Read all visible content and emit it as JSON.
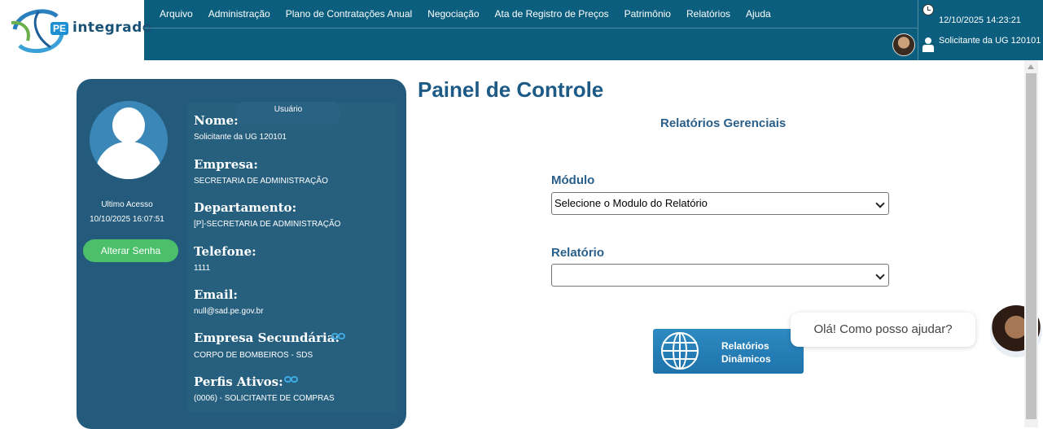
{
  "brand": {
    "badge": "PE",
    "name": "integrado"
  },
  "menu": [
    "Arquivo",
    "Administração",
    "Plano de Contratações Anual",
    "Negociação",
    "Ata de Registro de Preços",
    "Patrimônio",
    "Relatórios",
    "Ajuda"
  ],
  "status": {
    "datetime": "12/10/2025 14:23:21",
    "role": "Solicitante da UG 120101"
  },
  "profile": {
    "tab_label": "Usuário",
    "last_access_label": "Ultimo Acesso",
    "last_access_value": "10/10/2025 16:07:51",
    "change_password": "Alterar Senha",
    "fields": [
      {
        "label": "Nome:",
        "value": "Solicitante da UG 120101"
      },
      {
        "label": "Empresa:",
        "value": "SECRETARIA DE ADMINISTRAÇÃO"
      },
      {
        "label": "Departamento:",
        "value": "[P]-SECRETARIA DE ADMINISTRAÇÃO"
      },
      {
        "label": "Telefone:",
        "value": "1111"
      },
      {
        "label": "Email:",
        "value": "null@sad.pe.gov.br"
      },
      {
        "label": "Empresa Secundária:",
        "value": "CORPO DE BOMBEIROS - SDS"
      },
      {
        "label": "Perfis Ativos:",
        "value": "(0006) - SOLICITANTE DE COMPRAS"
      }
    ]
  },
  "main": {
    "title": "Painel de Controle",
    "section": "Relatórios Gerenciais",
    "modulo_label": "Módulo",
    "modulo_value": "Selecione o Modulo do Relatório",
    "relatorio_label": "Relatório",
    "relatorio_value": "",
    "dynamic_button": [
      "Relatórios",
      "Dinâmicos"
    ]
  },
  "chat": {
    "greeting": "Olá! Como posso ajudar?"
  },
  "colors": {
    "header": "#0b5e7e",
    "card": "#245b7c",
    "accent_green": "#4cbf6a",
    "title_blue": "#1d5a86"
  }
}
